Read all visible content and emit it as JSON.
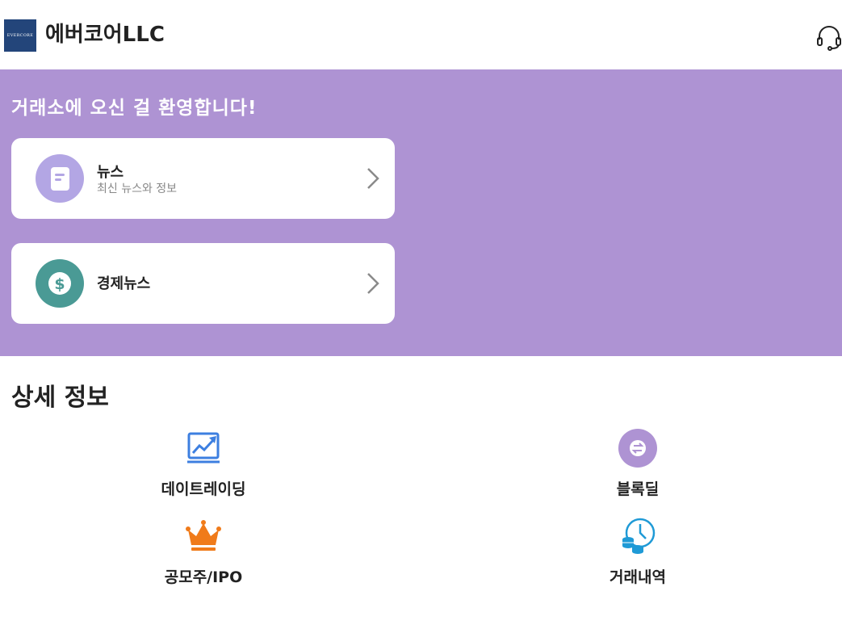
{
  "header": {
    "logo_text": "EVERCORE",
    "title": "에버코어LLC",
    "support_icon": "headset-icon"
  },
  "hero": {
    "background_color": "#ae93d3",
    "welcome": "거래소에 오신 걸 환영합니다!",
    "cards": [
      {
        "title": "뉴스",
        "subtitle": "최신 뉴스와 정보",
        "icon": "document-icon",
        "icon_color": "#b3a6e4"
      },
      {
        "title": "경제뉴스",
        "subtitle": "",
        "icon": "dollar-icon",
        "icon_color": "#4a9a95"
      }
    ]
  },
  "details": {
    "title": "상세 정보",
    "items": [
      {
        "label": "데이트레이딩",
        "icon": "chart-trend-icon",
        "color": "#3d7fe0"
      },
      {
        "label": "블록딜",
        "icon": "exchange-icon",
        "color": "#ae93d3"
      },
      {
        "label": "공모주/IPO",
        "icon": "crown-icon",
        "color": "#f07b1a"
      },
      {
        "label": "거래내역",
        "icon": "clock-coins-icon",
        "color": "#1f9ad6"
      }
    ]
  }
}
